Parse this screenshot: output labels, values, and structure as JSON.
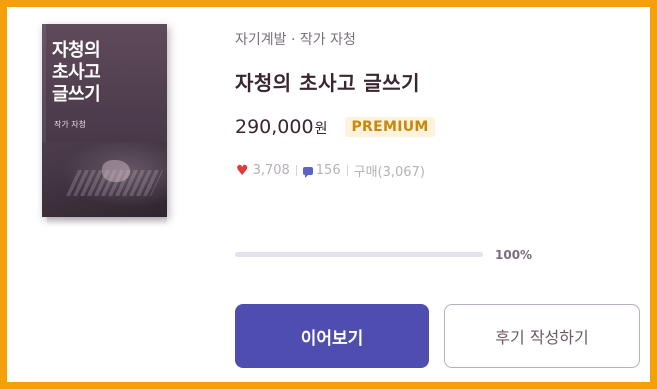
{
  "cover": {
    "title": "자청의\n초사고\n글쓰기",
    "author": "작가 자청"
  },
  "product": {
    "category": "자기계발 · 작가 자청",
    "title": "자청의 초사고 글쓰기",
    "price": "290,000",
    "price_unit": "원",
    "badge": "PREMIUM"
  },
  "stats": {
    "likes": "3,708",
    "comments": "156",
    "purchases": "구매(3,067)"
  },
  "progress": {
    "value": 1.0,
    "label": "100%"
  },
  "actions": {
    "continue_label": "이어보기",
    "review_label": "후기 작성하기"
  },
  "colors": {
    "border": "#f5a00a",
    "primary": "#4f4db0",
    "premium": "#c68a0c",
    "heart": "#e23b3b"
  },
  "icons": {
    "heart": "heart-icon",
    "comment": "comment-icon"
  }
}
